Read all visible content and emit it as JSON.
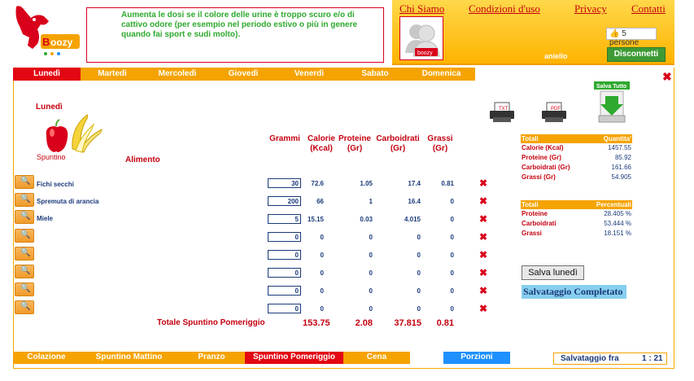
{
  "header": {
    "tip": "Aumenta le dosi se il colore delle urine è troppo scuro e/o di cattivo odore (per esempio nel periodo estivo o più in genere quando fai sport e sudi molto).",
    "logo_text": "oozy",
    "links": [
      "Chi Siamo",
      "Condizioni d'uso",
      "Privacy",
      "Contatti"
    ],
    "avatar_label": "boozy",
    "likes": "5 persone",
    "username": "aniello",
    "disconnect": "Disconnetti"
  },
  "days": [
    "Lunedì",
    "Martedì",
    "Mercoledì",
    "Giovedì",
    "Venerdì",
    "Sabato",
    "Domenica"
  ],
  "active_day": "Lunedì",
  "main": {
    "day_title": "Lunedì",
    "meal_icon_label": "Spuntino",
    "alimento": "Alimento",
    "columns": {
      "grammi": "Grammi",
      "calorie": "Calorie\n(Kcal)",
      "proteine": "Proteine\n(Gr)",
      "carboidrati": "Carboidrati\n(Gr)",
      "grassi": "Grassi\n(Gr)"
    },
    "rows": [
      {
        "name": "Fichi secchi",
        "qty": "30",
        "cal": "72.6",
        "prot": "1.05",
        "carb": "17.4",
        "fat": "0.81"
      },
      {
        "name": "Spremuta di arancia",
        "qty": "200",
        "cal": "66",
        "prot": "1",
        "carb": "16.4",
        "fat": "0"
      },
      {
        "name": "Miele",
        "qty": "5",
        "cal": "15.15",
        "prot": "0.03",
        "carb": "4.015",
        "fat": "0"
      },
      {
        "name": "",
        "qty": "0",
        "cal": "0",
        "prot": "0",
        "carb": "0",
        "fat": "0"
      },
      {
        "name": "",
        "qty": "0",
        "cal": "0",
        "prot": "0",
        "carb": "0",
        "fat": "0"
      },
      {
        "name": "",
        "qty": "0",
        "cal": "0",
        "prot": "0",
        "carb": "0",
        "fat": "0"
      },
      {
        "name": "",
        "qty": "0",
        "cal": "0",
        "prot": "0",
        "carb": "0",
        "fat": "0"
      },
      {
        "name": "",
        "qty": "0",
        "cal": "0",
        "prot": "0",
        "carb": "0",
        "fat": "0"
      }
    ],
    "totals_label": "Totale Spuntino Pomeriggio",
    "totals": {
      "cal": "153.75",
      "prot": "2.08",
      "carb": "37.815",
      "fat": "0.81"
    }
  },
  "side": {
    "txt_label": "TXT",
    "pdf_label": "PDF",
    "save_all": "Salva Tutto",
    "totals_head": [
      "Totali",
      "Quantita'"
    ],
    "totals_rows": [
      {
        "label": "Calorie (Kcal)",
        "value": "1457.55"
      },
      {
        "label": "Proteine (Gr)",
        "value": "85.92"
      },
      {
        "label": "Carboidrati (Gr)",
        "value": "161.66"
      },
      {
        "label": "Grassi (Gr)",
        "value": "54.905"
      }
    ],
    "perc_head": [
      "Totali",
      "Percentuali"
    ],
    "perc_rows": [
      {
        "label": "Proteine",
        "value": "28.405 %"
      },
      {
        "label": "Carboidrati",
        "value": "53.444 %"
      },
      {
        "label": "Grassi",
        "value": "18.151 %"
      }
    ],
    "save_day": "Salva lunedì",
    "save_done": "Salvataggio Completato"
  },
  "meals": [
    "Colazione",
    "Spuntino Mattino",
    "Pranzo",
    "Spuntino Pomeriggio",
    "Cena"
  ],
  "active_meal": "Spuntino Pomeriggio",
  "portions": "Porzioni",
  "timer": {
    "label": "Salvataggio fra",
    "value": "1 : 21"
  },
  "colors": {
    "accent": "#f5a300",
    "active": "#e30613",
    "brand_red": "#c4000f",
    "value_blue": "#1b3a7a",
    "tip_green": "#2fa92f"
  }
}
